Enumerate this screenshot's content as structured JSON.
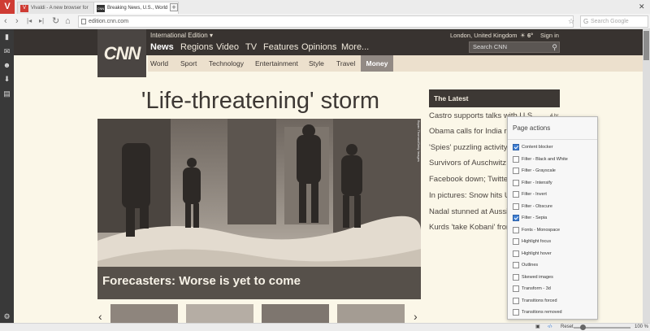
{
  "browser": {
    "logo": "V",
    "tabs": [
      {
        "title": "Vivaldi - A new browser for",
        "favicon": "V"
      },
      {
        "title": "Breaking News, U.S., World",
        "favicon": "CNN"
      }
    ],
    "new_tab": "+",
    "window": {
      "close": "✕"
    },
    "nav": {
      "back": "‹",
      "forward": "›",
      "rewind": "|◂",
      "fastforward": "▸|",
      "reload": "↻",
      "home": "⌂"
    },
    "url": "edition.cnn.com",
    "bookmark_icon": "bookmark-icon",
    "search_placeholder": "Search Google",
    "search_engine_glyph": "G"
  },
  "side_panel": {
    "icons": [
      "bookmark-icon",
      "mail-icon",
      "contacts-icon",
      "download-icon",
      "notes-icon"
    ],
    "settings": "settings-icon"
  },
  "status_bar": {
    "reset": "Reset",
    "zoom": "100 %",
    "zoom_level": 0.1
  },
  "cnn": {
    "logo": "CNN",
    "edition": "International Edition ▾",
    "location": "London, United Kingdom",
    "weather": "6°",
    "sign_in": "Sign in",
    "search_placeholder": "Search CNN",
    "main_nav": [
      "News",
      "Regions",
      "Video",
      "TV",
      "Features",
      "Opinions",
      "More..."
    ],
    "sub_nav": [
      "World",
      "Sport",
      "Technology",
      "Entertainment",
      "Style",
      "Travel",
      "Money"
    ],
    "headline": "'Life-threatening' storm",
    "hero_caption": "Forecasters: Worse is yet to come",
    "photo_credit": "Bryan Thomas/Getty Images",
    "latest": {
      "heading": "The Latest",
      "time": "4 hr",
      "items": [
        "Castro supports talks with U.S.",
        "Obama calls for India re",
        "'Spies' puzzling activity",
        "Survivors of Auschwitz r",
        "Facebook down; Twitter",
        "In pictures: Snow hits U",
        "Nadal stunned at Aussie",
        "Kurds 'take Kobani' fror"
      ]
    },
    "carousel": {
      "prev": "‹",
      "next": "›"
    }
  },
  "page_actions": {
    "title": "Page actions",
    "items": [
      {
        "label": "Content blocker",
        "checked": true
      },
      {
        "label": "Filter - Black and White",
        "checked": false
      },
      {
        "label": "Filter - Grayscale",
        "checked": false
      },
      {
        "label": "Filter - Intensify",
        "checked": false
      },
      {
        "label": "Filter - Invert",
        "checked": false
      },
      {
        "label": "Filter - Obscure",
        "checked": false
      },
      {
        "label": "Filter - Sepia",
        "checked": true
      },
      {
        "label": "Fonts - Monospace",
        "checked": false
      },
      {
        "label": "Highlight focus",
        "checked": false
      },
      {
        "label": "Highlight hover",
        "checked": false
      },
      {
        "label": "Outlines",
        "checked": false
      },
      {
        "label": "Skewed images",
        "checked": false
      },
      {
        "label": "Transform - 3d",
        "checked": false
      },
      {
        "label": "Transitions forced",
        "checked": false
      },
      {
        "label": "Transitions removed",
        "checked": false
      }
    ]
  }
}
